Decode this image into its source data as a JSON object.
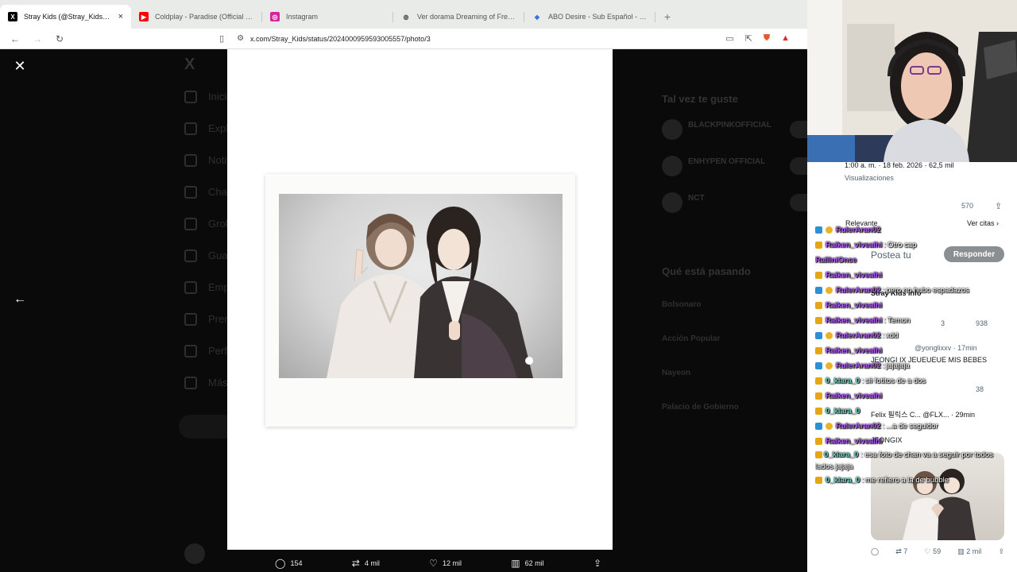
{
  "browser": {
    "tabs": [
      {
        "title": "Stray Kids (@Stray_Kids) / X",
        "icon": "x-icon",
        "active": true
      },
      {
        "title": "Coldplay - Paradise (Official Video)",
        "icon": "youtube-icon"
      },
      {
        "title": "Instagram",
        "icon": "instagram-icon"
      },
      {
        "title": "Ver dorama Dreaming of Freaking Fa",
        "icon": "globe-icon"
      },
      {
        "title": "ABO Desire - Sub Español - Serie",
        "icon": "shield-icon"
      }
    ],
    "close_tab": "×",
    "new_tab": "+",
    "url": "x.com/Stray_Kids/status/2024000959593005557/photo/3"
  },
  "background_page": {
    "nav_items": [
      "Inicio",
      "Explorar",
      "Notificaciones",
      "Chat",
      "Grok",
      "Guardados",
      "Empleos",
      "Premium",
      "Perfil",
      "Más"
    ],
    "right_title": "Tal vez te guste",
    "suggestions": [
      "BLACKPINKOFFICIAL",
      "ENHYPEN OFFICIAL",
      "NCT"
    ],
    "trending_title": "Qué está pasando",
    "trends": [
      "Bolsonaro",
      "Acción Popular",
      "Nayeon",
      "Palacio de Gobierno"
    ]
  },
  "viewer": {
    "close_label": "✕",
    "prev_label": "←",
    "actions": [
      {
        "icon": "reply-icon",
        "glyph": "◯",
        "count": "154"
      },
      {
        "icon": "retweet-icon",
        "glyph": "⇄",
        "count": "4 mil"
      },
      {
        "icon": "like-icon",
        "glyph": "♡",
        "count": "12 mil"
      },
      {
        "icon": "views-icon",
        "glyph": "▥",
        "count": "62 mil"
      },
      {
        "icon": "share-icon",
        "glyph": "⇪",
        "count": ""
      }
    ]
  },
  "tweet_panel": {
    "meta": "1:00 a. m. · 18 feb. 2026 · 62,5 mil",
    "views_label": "Visualizaciones",
    "bookmark_count": "570",
    "filter_label": "Relevante",
    "quotes_link": "Ver citas ›",
    "reply_placeholder": "Postea tu",
    "reply_button": "Responder",
    "reply1_name": "Stray Kids Info",
    "reply1_stats": [
      "3",
      "938"
    ],
    "reply2_handle": "@yonglixxv · 17min",
    "reply2_text": "JEONGI IX JEUEUEUE MIS BEBES",
    "reply2_stats": [
      "38"
    ],
    "reply3_handle": "Felix 필릭스 C... @FLX... · 29min",
    "reply3_text": "JEONGIX",
    "bottom_stats": [
      "7",
      "59",
      "2 mil"
    ]
  },
  "chat": [
    {
      "badges": [
        "blue",
        "gold"
      ],
      "user": "RulerAran02",
      "color": "purple",
      "msg": ""
    },
    {
      "badges": [
        "crown"
      ],
      "user": "Raiken_vivealhi",
      "color": "purple",
      "msg": "Otro cap"
    },
    {
      "badges": [],
      "user": "RalliniOnce",
      "color": "purple",
      "msg": ""
    },
    {
      "badges": [
        "crown"
      ],
      "user": "Raiken_vivealhi",
      "color": "purple",
      "msg": ""
    },
    {
      "badges": [
        "blue",
        "gold"
      ],
      "user": "RulerAran02",
      "color": "purple",
      "msg": "pero no hubo espadazos"
    },
    {
      "badges": [
        "crown"
      ],
      "user": "Raiken_vivealhi",
      "color": "purple",
      "msg": ""
    },
    {
      "badges": [
        "crown"
      ],
      "user": "Raiken_vivealhi",
      "color": "purple",
      "msg": "Temon"
    },
    {
      "badges": [
        "blue",
        "gold"
      ],
      "user": "RulerAran02",
      "color": "purple",
      "msg": "xdd"
    },
    {
      "badges": [
        "crown"
      ],
      "user": "Raiken_vivealhi",
      "color": "purple",
      "msg": ""
    },
    {
      "badges": [
        "blue",
        "gold"
      ],
      "user": "RulerAran02",
      "color": "purple",
      "msg": "jajajaja"
    },
    {
      "badges": [
        "crown"
      ],
      "user": "0_kiara_0",
      "color": "teal",
      "msg": "sii fotitos de a dos"
    },
    {
      "badges": [
        "crown"
      ],
      "user": "Raiken_vivealhi",
      "color": "purple",
      "msg": ""
    },
    {
      "badges": [
        "crown"
      ],
      "user": "0_kiara_0",
      "color": "teal",
      "msg": ""
    },
    {
      "badges": [
        "blue",
        "gold"
      ],
      "user": "RulerAran02",
      "color": "purple",
      "msg": "...a de seguidor"
    },
    {
      "badges": [
        "crown"
      ],
      "user": "Raiken_vivealhi",
      "color": "purple",
      "msg": ""
    },
    {
      "badges": [
        "crown"
      ],
      "user": "0_kiara_0",
      "color": "teal",
      "msg": "esa foto de chan va a seguir por todos lados jajaja",
      "wrap": true
    },
    {
      "badges": [
        "crown"
      ],
      "user": "0_kiara_0",
      "color": "teal",
      "msg": "me refiero a la de bubble"
    }
  ]
}
